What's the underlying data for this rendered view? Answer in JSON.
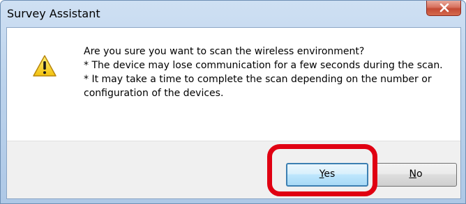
{
  "window": {
    "title": "Survey Assistant"
  },
  "dialog": {
    "icon": "warning-icon",
    "lines": [
      "Are you sure you want to scan the wireless environment?",
      "* The device may lose communication for a few seconds during the scan.",
      "* It may take a time to complete the scan depending on the number or configuration of the devices."
    ]
  },
  "buttons": {
    "yes_mnemonic": "Y",
    "yes_rest": "es",
    "no_mnemonic": "N",
    "no_rest": "o"
  },
  "colors": {
    "highlight": "#e00012",
    "default_button_border": "#3c7fb1"
  }
}
